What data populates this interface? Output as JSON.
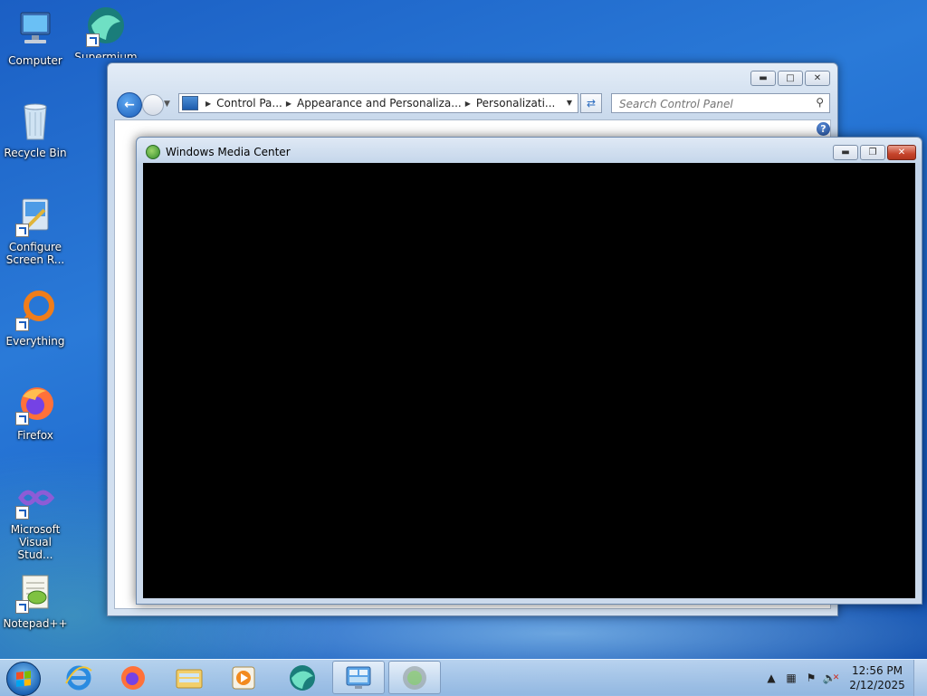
{
  "desktop_icons": [
    {
      "label": "Computer",
      "icon": "computer-icon"
    },
    {
      "label": "Supermium",
      "icon": "supermium-icon"
    },
    {
      "label": "Recycle Bin",
      "icon": "recycle-bin-icon"
    },
    {
      "label": "Configure Screen R...",
      "icon": "configure-screen-icon"
    },
    {
      "label": "Everything",
      "icon": "everything-icon"
    },
    {
      "label": "Firefox",
      "icon": "firefox-icon"
    },
    {
      "label": "Microsoft Visual Stud...",
      "icon": "visual-studio-icon"
    },
    {
      "label": "Notepad++",
      "icon": "notepadpp-icon"
    }
  ],
  "control_panel": {
    "breadcrumbs": [
      "Control Pa...",
      "Appearance and Personaliza...",
      "Personalizati..."
    ],
    "search_placeholder": "Search Control Panel",
    "help_label": "?"
  },
  "wmc_window": {
    "title": "Windows Media Center"
  },
  "taskbar": {
    "items": [
      {
        "name": "internet-explorer",
        "active": false
      },
      {
        "name": "firefox",
        "active": false
      },
      {
        "name": "file-explorer",
        "active": false
      },
      {
        "name": "media-player",
        "active": false
      },
      {
        "name": "supermium",
        "active": false
      },
      {
        "name": "control-panel",
        "active": true
      },
      {
        "name": "windows-media-center",
        "active": true
      }
    ],
    "time": "12:56 PM",
    "date": "2/12/2025"
  }
}
